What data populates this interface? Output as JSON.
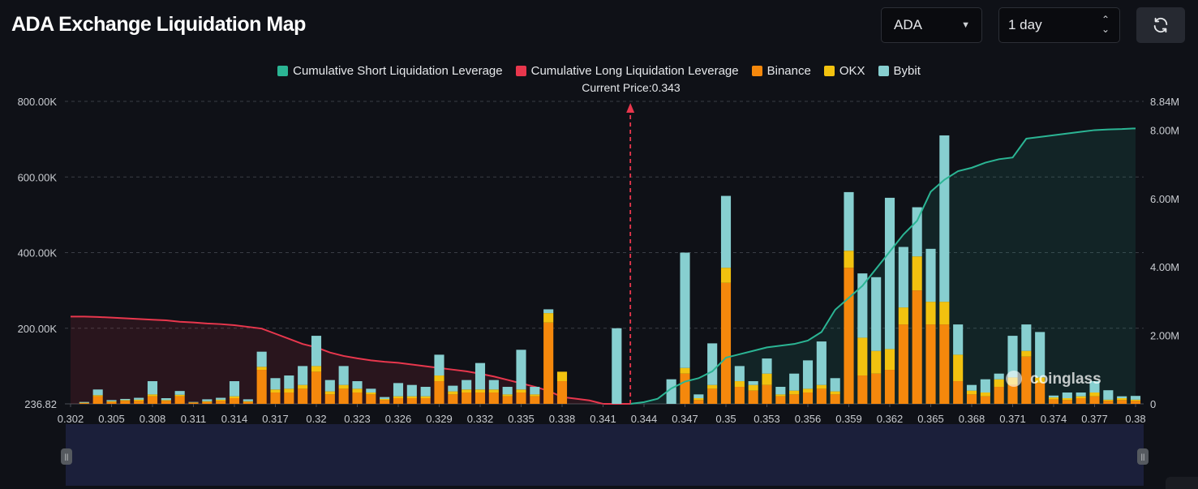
{
  "title": "ADA Exchange Liquidation Map",
  "controls": {
    "symbol": "ADA",
    "range": "1 day",
    "refresh_icon": "refresh-icon"
  },
  "colors": {
    "short_cum": "#2bb594",
    "long_cum": "#e8374d",
    "binance": "#f5880c",
    "okx": "#f2c20f",
    "bybit": "#87cfd0",
    "background": "#0f1117",
    "current_price_line": "#e8374d"
  },
  "chart_data": {
    "type": "bar",
    "legend": [
      {
        "name": "Cumulative Short Liquidation Leverage",
        "color": "#2bb594"
      },
      {
        "name": "Cumulative Long Liquidation Leverage",
        "color": "#e8374d"
      },
      {
        "name": "Binance",
        "color": "#f5880c"
      },
      {
        "name": "OKX",
        "color": "#f2c20f"
      },
      {
        "name": "Bybit",
        "color": "#87cfd0"
      }
    ],
    "legend_position": "top-center",
    "current_price_label": "Current Price:0.343",
    "current_price": 0.343,
    "x_tick_labels": [
      "0.302",
      "0.305",
      "0.308",
      "0.311",
      "0.314",
      "0.317",
      "0.32",
      "0.323",
      "0.326",
      "0.329",
      "0.332",
      "0.335",
      "0.338",
      "0.341",
      "0.344",
      "0.347",
      "0.35",
      "0.353",
      "0.356",
      "0.359",
      "0.362",
      "0.365",
      "0.368",
      "0.371",
      "0.374",
      "0.377",
      "0.38"
    ],
    "y_left_tick_labels": [
      "236.82",
      "200.00K",
      "400.00K",
      "600.00K",
      "800.00K"
    ],
    "y_left_ticks": [
      0,
      200000,
      400000,
      600000,
      800000
    ],
    "y_left_range": [
      0,
      800000
    ],
    "y_right_tick_labels": [
      "0",
      "2.00M",
      "4.00M",
      "6.00M",
      "8.00M",
      "8.84M"
    ],
    "y_right_ticks": [
      0,
      2000000,
      4000000,
      6000000,
      8000000,
      8840000
    ],
    "y_right_range": [
      0,
      8840000
    ],
    "x_range": [
      0.302,
      0.38
    ],
    "grid": true,
    "bars": {
      "price": [
        0.302,
        0.303,
        0.304,
        0.305,
        0.306,
        0.307,
        0.308,
        0.309,
        0.31,
        0.311,
        0.312,
        0.313,
        0.314,
        0.315,
        0.316,
        0.317,
        0.318,
        0.319,
        0.32,
        0.321,
        0.322,
        0.323,
        0.324,
        0.325,
        0.326,
        0.327,
        0.328,
        0.329,
        0.33,
        0.331,
        0.332,
        0.333,
        0.334,
        0.335,
        0.336,
        0.337,
        0.338,
        0.339,
        0.34,
        0.341,
        0.342,
        0.343,
        0.344,
        0.345,
        0.346,
        0.347,
        0.348,
        0.349,
        0.35,
        0.351,
        0.352,
        0.353,
        0.354,
        0.355,
        0.356,
        0.357,
        0.358,
        0.359,
        0.36,
        0.361,
        0.362,
        0.363,
        0.364,
        0.365,
        0.366,
        0.367,
        0.368,
        0.369,
        0.37,
        0.371,
        0.372,
        0.373,
        0.374,
        0.375,
        0.376,
        0.377,
        0.378,
        0.379,
        0.38
      ],
      "binance": [
        0,
        2000,
        20000,
        5000,
        8000,
        8000,
        20000,
        8000,
        20000,
        3000,
        5000,
        8000,
        15000,
        5000,
        90000,
        30000,
        30000,
        40000,
        85000,
        25000,
        40000,
        30000,
        25000,
        10000,
        15000,
        15000,
        15000,
        60000,
        25000,
        30000,
        30000,
        30000,
        20000,
        30000,
        20000,
        215000,
        60000,
        0,
        0,
        0,
        0,
        0,
        0,
        0,
        0,
        80000,
        10000,
        40000,
        320000,
        45000,
        35000,
        50000,
        20000,
        25000,
        30000,
        40000,
        25000,
        360000,
        75000,
        80000,
        90000,
        210000,
        300000,
        210000,
        210000,
        60000,
        25000,
        20000,
        45000,
        50000,
        125000,
        55000,
        12000,
        10000,
        15000,
        20000,
        8000,
        10000,
        8000
      ],
      "okx": [
        0,
        1000,
        3000,
        2000,
        2000,
        3000,
        5000,
        2000,
        4000,
        1000,
        2000,
        3000,
        5000,
        2000,
        8000,
        8000,
        10000,
        10000,
        15000,
        8000,
        10000,
        10000,
        5000,
        3000,
        5000,
        5000,
        5000,
        15000,
        8000,
        8000,
        8000,
        8000,
        5000,
        8000,
        5000,
        25000,
        25000,
        0,
        0,
        0,
        0,
        0,
        0,
        0,
        0,
        15000,
        5000,
        10000,
        40000,
        15000,
        15000,
        30000,
        5000,
        10000,
        10000,
        10000,
        8000,
        45000,
        100000,
        60000,
        55000,
        45000,
        90000,
        60000,
        60000,
        70000,
        10000,
        10000,
        20000,
        20000,
        15000,
        15000,
        5000,
        5000,
        5000,
        10000,
        3000,
        5000,
        3000
      ],
      "bybit": [
        0,
        2000,
        15000,
        3000,
        3000,
        5000,
        35000,
        5000,
        10000,
        1000,
        5000,
        5000,
        40000,
        5000,
        40000,
        30000,
        35000,
        50000,
        80000,
        30000,
        50000,
        20000,
        10000,
        5000,
        35000,
        30000,
        25000,
        55000,
        15000,
        25000,
        70000,
        25000,
        20000,
        105000,
        20000,
        10000,
        0,
        0,
        0,
        0,
        200000,
        0,
        0,
        0,
        65000,
        305000,
        10000,
        110000,
        190000,
        40000,
        10000,
        40000,
        20000,
        45000,
        75000,
        115000,
        35000,
        155000,
        170000,
        195000,
        400000,
        160000,
        130000,
        140000,
        440000,
        80000,
        15000,
        35000,
        15000,
        110000,
        70000,
        120000,
        5000,
        15000,
        10000,
        30000,
        25000,
        5000,
        10000
      ]
    },
    "short_cumulative": {
      "x": [
        0.343,
        0.344,
        0.345,
        0.346,
        0.347,
        0.348,
        0.349,
        0.35,
        0.351,
        0.352,
        0.353,
        0.354,
        0.355,
        0.356,
        0.357,
        0.358,
        0.359,
        0.36,
        0.361,
        0.362,
        0.363,
        0.364,
        0.365,
        0.366,
        0.367,
        0.368,
        0.369,
        0.37,
        0.371,
        0.372,
        0.373,
        0.374,
        0.375,
        0.376,
        0.377,
        0.378,
        0.379,
        0.38
      ],
      "y": [
        0,
        50000,
        150000,
        450000,
        650000,
        750000,
        950000,
        1350000,
        1450000,
        1550000,
        1650000,
        1700000,
        1750000,
        1850000,
        2100000,
        2750000,
        3100000,
        3450000,
        3950000,
        4450000,
        4950000,
        5350000,
        6200000,
        6550000,
        6800000,
        6900000,
        7050000,
        7150000,
        7200000,
        7750000,
        7800000,
        7850000,
        7900000,
        7950000,
        8000000,
        8020000,
        8030000,
        8050000
      ]
    },
    "long_cumulative": {
      "x": [
        0.302,
        0.303,
        0.304,
        0.305,
        0.306,
        0.307,
        0.308,
        0.309,
        0.31,
        0.311,
        0.312,
        0.313,
        0.314,
        0.315,
        0.316,
        0.317,
        0.318,
        0.319,
        0.32,
        0.321,
        0.322,
        0.323,
        0.324,
        0.325,
        0.326,
        0.327,
        0.328,
        0.329,
        0.33,
        0.331,
        0.332,
        0.333,
        0.334,
        0.335,
        0.336,
        0.337,
        0.338,
        0.339,
        0.34,
        0.341,
        0.342,
        0.343
      ],
      "y": [
        2550000,
        2550000,
        2540000,
        2520000,
        2500000,
        2480000,
        2460000,
        2440000,
        2400000,
        2380000,
        2350000,
        2330000,
        2300000,
        2250000,
        2200000,
        2050000,
        1900000,
        1750000,
        1650000,
        1500000,
        1400000,
        1330000,
        1270000,
        1230000,
        1200000,
        1150000,
        1100000,
        1050000,
        1000000,
        950000,
        880000,
        800000,
        700000,
        600000,
        500000,
        380000,
        200000,
        150000,
        100000,
        0,
        0,
        0
      ]
    }
  }
}
